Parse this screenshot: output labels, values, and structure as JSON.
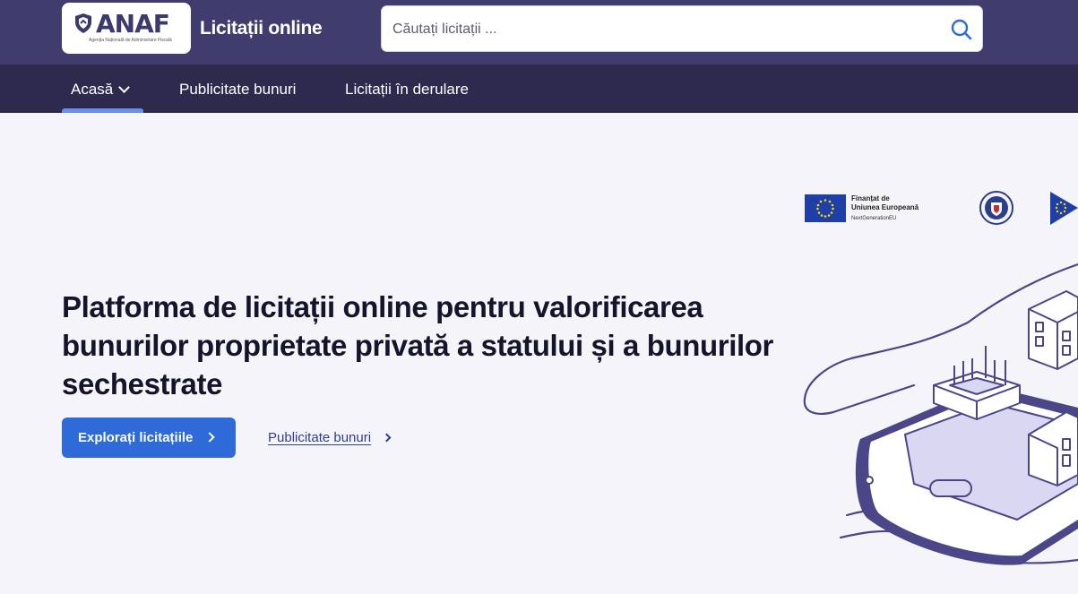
{
  "header": {
    "logo_text": "ANAF",
    "logo_subtext": "Agenția Națională de Administrare Fiscală",
    "site_title": "Licitații online",
    "search_placeholder": "Căutați licitații ..."
  },
  "nav": {
    "items": [
      {
        "label": "Acasă",
        "active": true
      },
      {
        "label": "Publicitate bunuri"
      },
      {
        "label": "Licitații în derulare"
      }
    ]
  },
  "hero": {
    "title": "Platforma de licitații online pentru valorificarea bunurilor proprietate privată a statului și a bunurilor sechestrate",
    "primary_button": "Explorați licitațiile",
    "secondary_link": "Publicitate bunuri"
  },
  "funding": {
    "line1": "Finanțat de",
    "line2": "Uniunea Europeană",
    "line3": "NextGenerationEU"
  },
  "colors": {
    "header_bg": "#403c6e",
    "nav_bg": "#2d2a4e",
    "accent_blue": "#2e6bd8",
    "page_bg": "#f4f4f9"
  },
  "icons": [
    "shield-icon",
    "search-icon",
    "chevron-down-icon",
    "chevron-right-icon",
    "eu-flag-icon",
    "crest-icon"
  ]
}
